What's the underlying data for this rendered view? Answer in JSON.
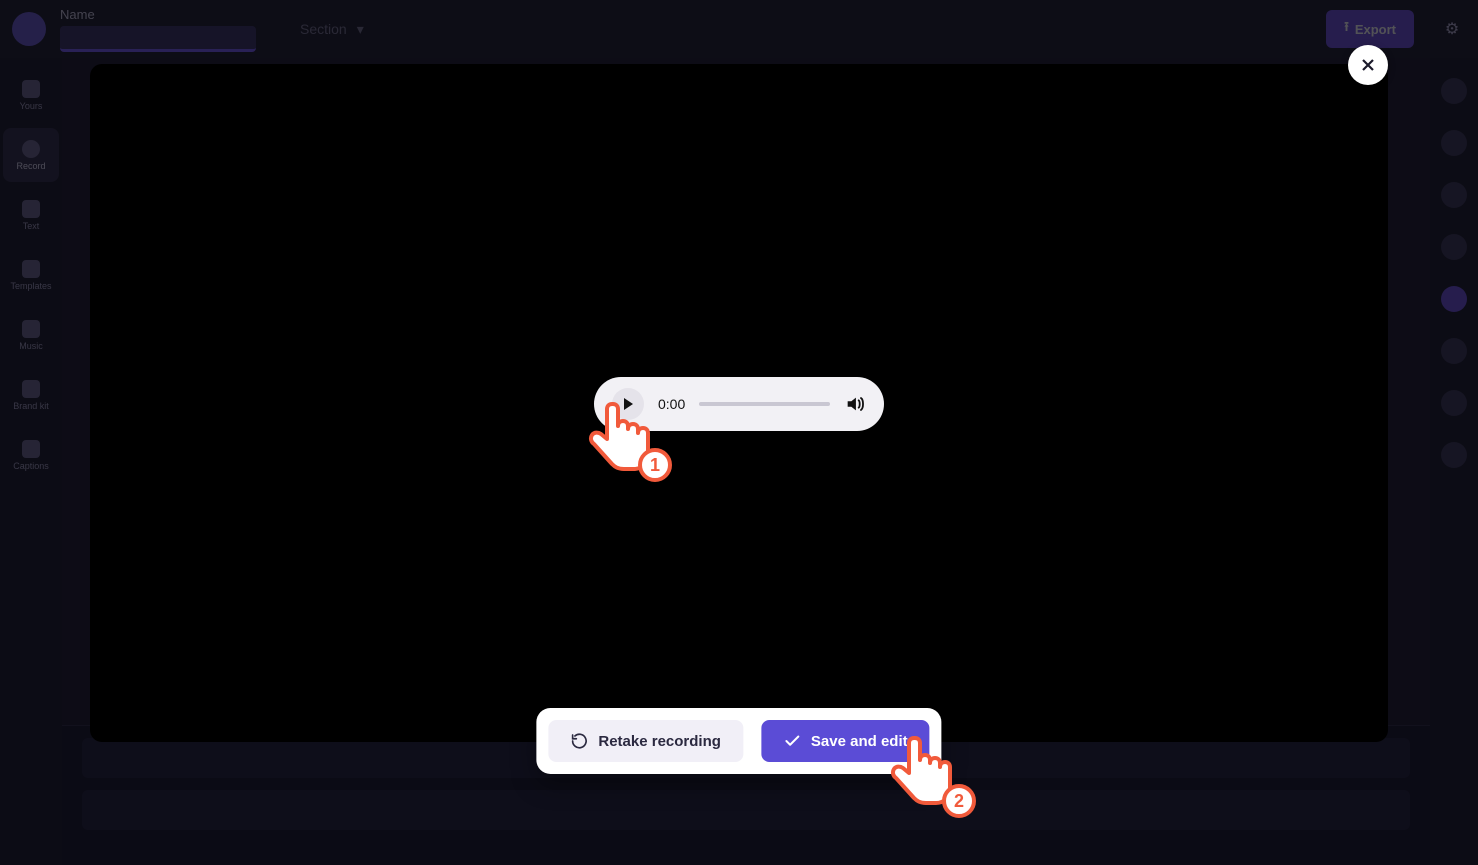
{
  "topbar": {
    "name_label": "Name",
    "menu_label": "Section",
    "export_label": "Export"
  },
  "left_nav": {
    "items": [
      {
        "label": "Yours"
      },
      {
        "label": "Record"
      },
      {
        "label": "Text"
      },
      {
        "label": "Templates"
      },
      {
        "label": "Music"
      },
      {
        "label": "Brand kit"
      },
      {
        "label": "Captions"
      }
    ],
    "active_index": 1
  },
  "player": {
    "time": "0:00"
  },
  "actions": {
    "retake_label": "Retake recording",
    "save_label": "Save and edit"
  },
  "tutorial": {
    "step1": "1",
    "step2": "2"
  }
}
